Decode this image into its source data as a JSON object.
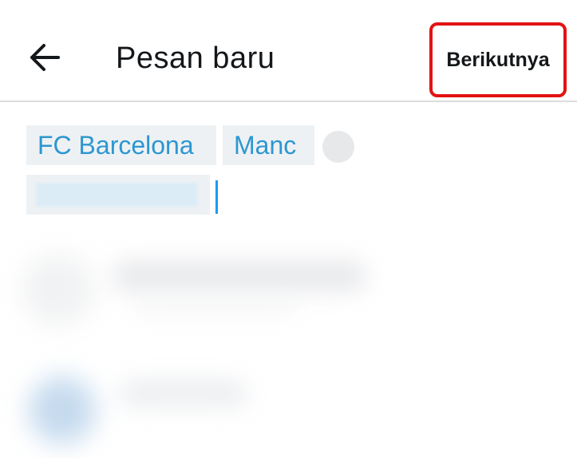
{
  "header": {
    "title": "Pesan baru",
    "next_label": "Berikutnya",
    "back_icon": "arrow-left-icon",
    "highlight_color": "#e31313"
  },
  "recipients": {
    "chips": [
      "FC Barcelona",
      "Manc"
    ],
    "chip_text_color": "#2c97d1",
    "chip_bg_color": "#eef1f4"
  },
  "search": {
    "value": "",
    "caret_color": "#1d9bf0"
  }
}
